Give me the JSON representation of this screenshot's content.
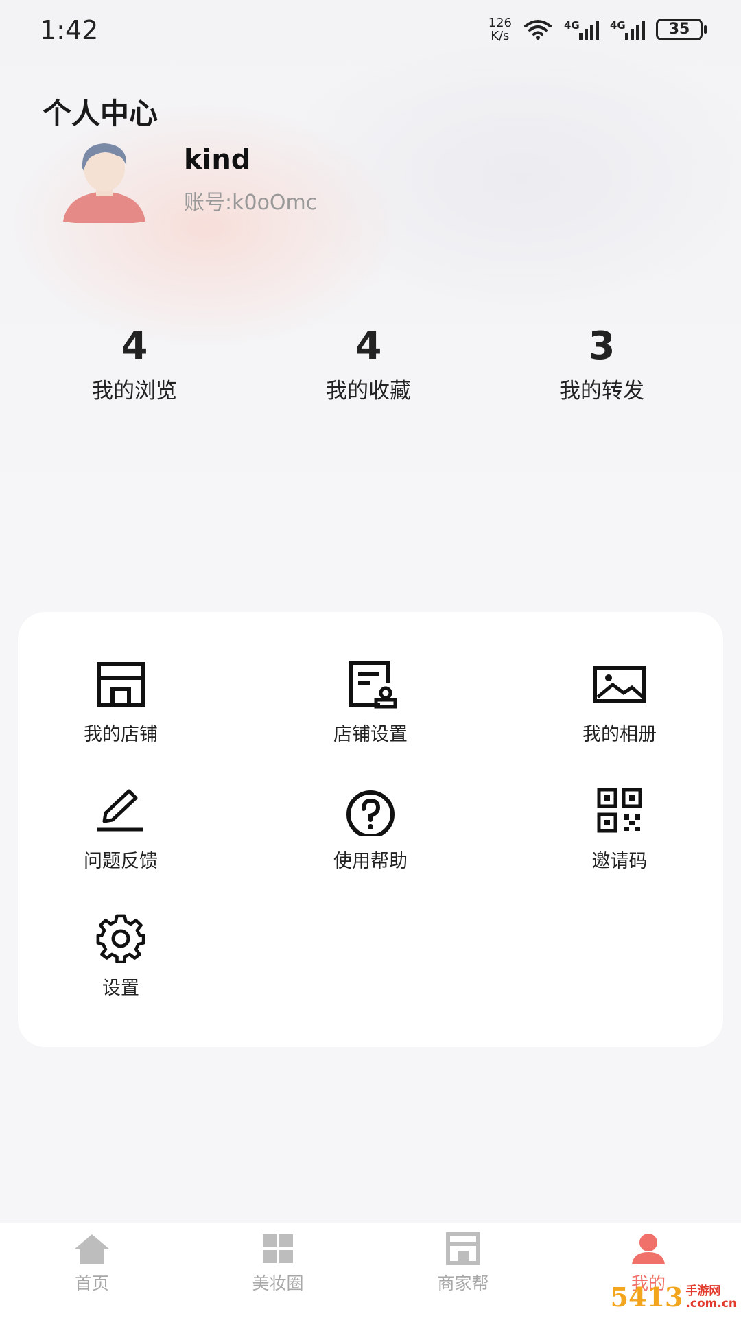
{
  "status_bar": {
    "time": "1:42",
    "net_speed_value": "126",
    "net_speed_unit": "K/s",
    "signal_1": "4G",
    "signal_2": "4G",
    "battery": "35"
  },
  "header": {
    "title": "个人中心"
  },
  "profile": {
    "name": "kind",
    "account": "账号:k0oOmc"
  },
  "stats": [
    {
      "value": "4",
      "label": "我的浏览"
    },
    {
      "value": "4",
      "label": "我的收藏"
    },
    {
      "value": "3",
      "label": "我的转发"
    }
  ],
  "menu": [
    {
      "label": "我的店铺",
      "icon": "store-icon"
    },
    {
      "label": "店铺设置",
      "icon": "store-settings-icon"
    },
    {
      "label": "我的相册",
      "icon": "image-icon"
    },
    {
      "label": "问题反馈",
      "icon": "pencil-icon"
    },
    {
      "label": "使用帮助",
      "icon": "question-icon"
    },
    {
      "label": "邀请码",
      "icon": "qr-code-icon"
    },
    {
      "label": "设置",
      "icon": "gear-icon"
    }
  ],
  "tabbar": [
    {
      "label": "首页",
      "icon": "home-icon"
    },
    {
      "label": "美妆圈",
      "icon": "grid-icon"
    },
    {
      "label": "商家帮",
      "icon": "shop-icon"
    },
    {
      "label": "我的",
      "icon": "person-icon",
      "active": true
    }
  ],
  "watermark": {
    "number": "5413",
    "text_line_1": "手游网",
    "text_line_2": ".com.cn"
  },
  "colors": {
    "accent": "#f0706a",
    "tab_inactive": "#a8a8a8",
    "background": "#f6f6f8"
  }
}
